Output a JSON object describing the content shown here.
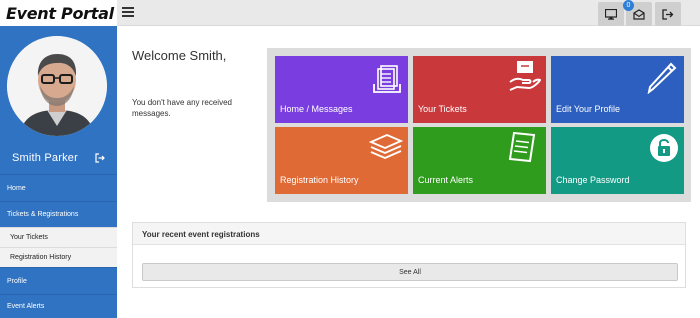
{
  "app": {
    "title": "Event Portal"
  },
  "topbar": {
    "notification_count": "0"
  },
  "sidebar": {
    "user_name": "Smith Parker",
    "items": [
      {
        "label": "Home"
      },
      {
        "label": "Tickets & Registrations"
      },
      {
        "label": "Your Tickets"
      },
      {
        "label": "Registration History"
      },
      {
        "label": "Profile"
      },
      {
        "label": "Event Alerts"
      }
    ]
  },
  "main": {
    "welcome": "Welcome Smith,",
    "no_messages": "You don't have any received messages.",
    "tiles": [
      {
        "label": "Home / Messages",
        "color": "#7a3ee0",
        "icon": "messages-icon"
      },
      {
        "label": "Your Tickets",
        "color": "#c9383b",
        "icon": "ticket-hand-icon"
      },
      {
        "label": "Edit Your Profile",
        "color": "#2c5fbf",
        "icon": "pencil-icon"
      },
      {
        "label": "Registration History",
        "color": "#e06a36",
        "icon": "stacked-papers-icon"
      },
      {
        "label": "Current Alerts",
        "color": "#2f9c1e",
        "icon": "clipboard-list-icon"
      },
      {
        "label": "Change Password",
        "color": "#129a84",
        "icon": "lock-icon"
      }
    ],
    "registrations": {
      "heading": "Your recent event registrations",
      "see_all": "See All"
    }
  }
}
